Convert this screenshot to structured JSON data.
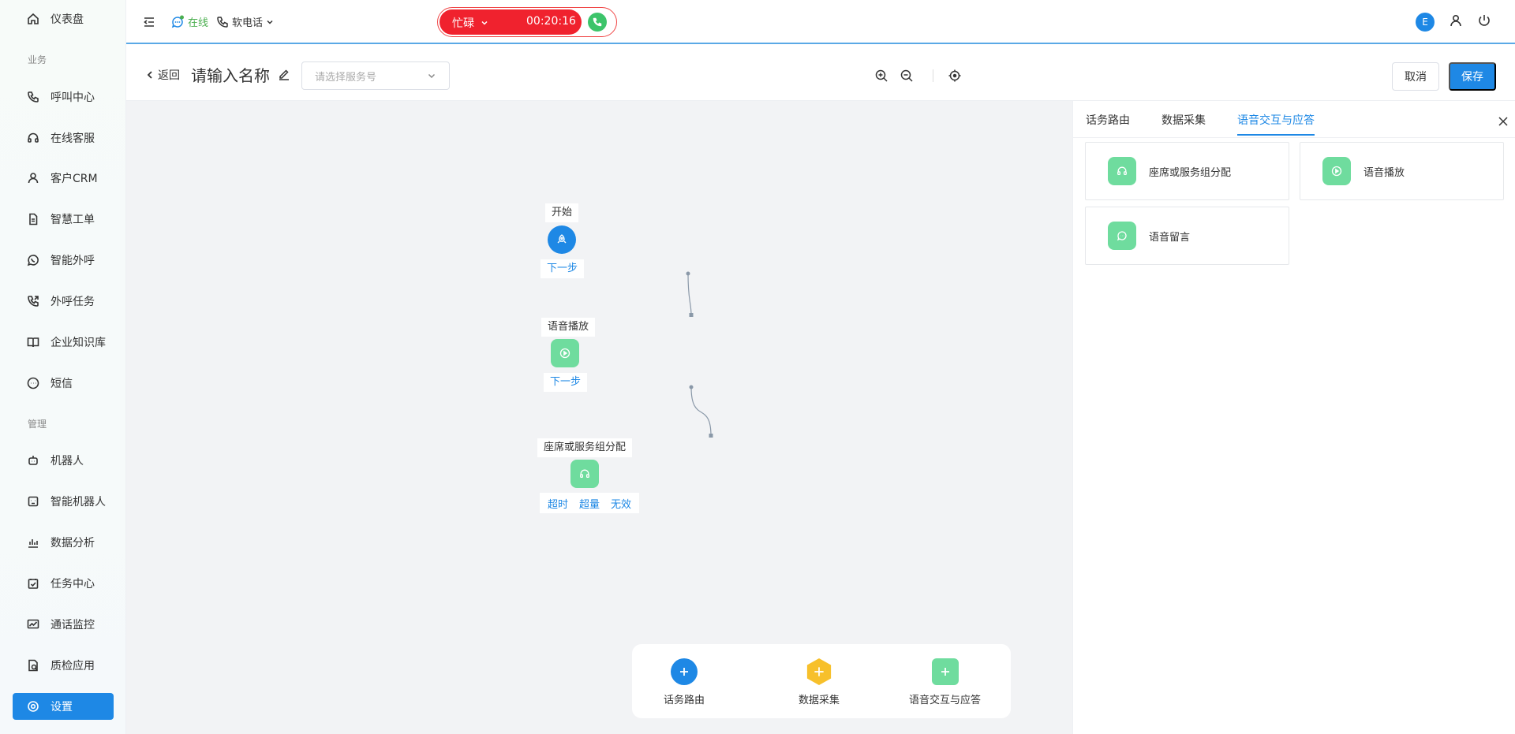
{
  "colors": {
    "primary": "#1e88e5",
    "green": "#6fdc9e",
    "busy_red": "#f0222e",
    "online_green": "#4caf50",
    "hex_yellow": "#f7c02b"
  },
  "sidebar": {
    "items": [
      {
        "label": "仪表盘",
        "icon": "home-icon"
      },
      {
        "label": "呼叫中心",
        "icon": "phone-icon"
      },
      {
        "label": "在线客服",
        "icon": "headset-icon"
      },
      {
        "label": "客户CRM",
        "icon": "user-icon"
      },
      {
        "label": "智慧工单",
        "icon": "document-icon"
      },
      {
        "label": "智能外呼",
        "icon": "whatsapp-icon"
      },
      {
        "label": "外呼任务",
        "icon": "phone-outgoing-icon"
      },
      {
        "label": "企业知识库",
        "icon": "book-icon"
      },
      {
        "label": "短信",
        "icon": "sms-icon"
      },
      {
        "label": "机器人",
        "icon": "robot-icon"
      },
      {
        "label": "智能机器人",
        "icon": "smart-robot-icon"
      },
      {
        "label": "数据分析",
        "icon": "bar-chart-icon"
      },
      {
        "label": "任务中心",
        "icon": "task-icon"
      },
      {
        "label": "通话监控",
        "icon": "monitor-icon"
      },
      {
        "label": "质检应用",
        "icon": "quality-icon"
      },
      {
        "label": "设置",
        "icon": "settings-icon"
      }
    ],
    "sections": {
      "business": "业务",
      "management": "管理"
    },
    "active_index": 15
  },
  "topbar": {
    "online_label": "在线",
    "softphone_label": "软电话",
    "busy_label": "忙碌",
    "call_timer": "00:20:16",
    "avatar_letter": "E"
  },
  "editor": {
    "back_label": "返回",
    "title": "请输入名称",
    "service_placeholder": "请选择服务号",
    "cancel_label": "取消",
    "save_label": "保存"
  },
  "flow": {
    "nodes": [
      {
        "label": "开始",
        "next": "下一步"
      },
      {
        "label": "语音播放",
        "next": "下一步"
      },
      {
        "label": "座席或服务组分配",
        "branches": [
          "超时",
          "超量",
          "无效"
        ]
      }
    ]
  },
  "palette": {
    "items": [
      {
        "label": "话务路由"
      },
      {
        "label": "数据采集"
      },
      {
        "label": "语音交互与应答"
      }
    ]
  },
  "panel": {
    "tabs": [
      "话务路由",
      "数据采集",
      "语音交互与应答"
    ],
    "active_tab": 2,
    "cards": [
      {
        "label": "座席或服务组分配",
        "icon": "headset-icon"
      },
      {
        "label": "语音播放",
        "icon": "play-icon"
      },
      {
        "label": "语音留言",
        "icon": "message-icon"
      }
    ]
  }
}
